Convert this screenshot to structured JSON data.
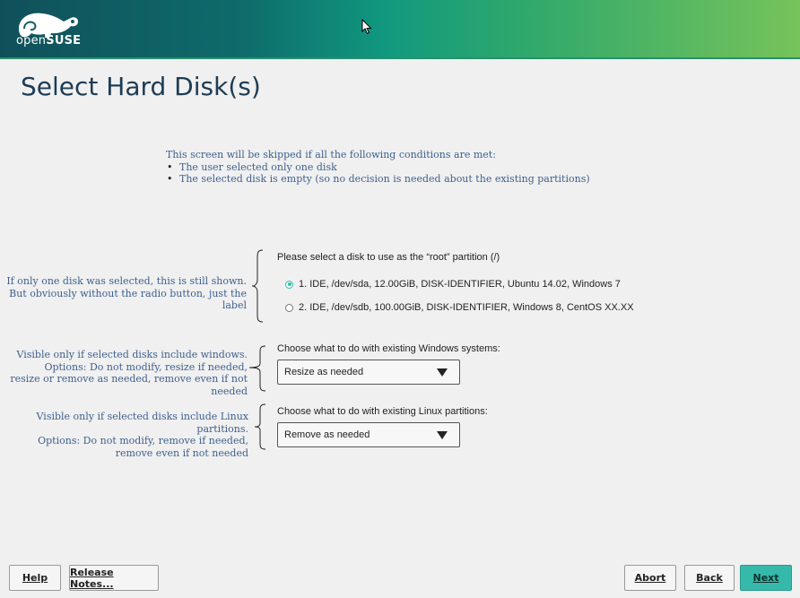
{
  "header": {
    "logo_text_light": "open",
    "logo_text_bold": "SUSE"
  },
  "page": {
    "title": "Select Hard Disk(s)"
  },
  "notes": {
    "top_intro": "This screen will be skipped if all the following conditions are met:",
    "top_bullets": [
      "The user selected only one disk",
      "The selected disk is empty (so no decision is needed about the existing partitions)"
    ],
    "disk_note": [
      "If only one disk was selected, this is still shown.",
      "But obviously without the radio button, just the label"
    ],
    "windows_note": [
      "Visible only if selected disks include windows.",
      "Options: Do not modify, resize if needed,",
      "resize or remove as needed, remove even if not needed"
    ],
    "linux_note": [
      "Visible only if selected disks include Linux partitions.",
      "Options: Do not modify, remove if needed,",
      "remove even if not needed"
    ]
  },
  "disk_selection": {
    "label": "Please select a disk to use as the “root” partition (/)",
    "options": [
      {
        "label": "1. IDE, /dev/sda, 12.00GiB, DISK-IDENTIFIER, Ubuntu 14.02, Windows 7",
        "selected": true
      },
      {
        "label": "2. IDE, /dev/sdb, 100.00GiB, DISK-IDENTIFIER, Windows 8, CentOS XX.XX",
        "selected": false
      }
    ]
  },
  "windows_action": {
    "label": "Choose what to do with existing Windows systems:",
    "value": "Resize as needed"
  },
  "linux_action": {
    "label": "Choose what to do with existing Linux partitions:",
    "value": "Remove as needed"
  },
  "buttons": {
    "help": "Help",
    "release_notes": "Release Notes...",
    "abort": "Abort",
    "back": "Back",
    "next": "Next"
  },
  "colors": {
    "accent": "#35b9ab",
    "note_text": "#3e5f8e",
    "title": "#1d3c55"
  },
  "icons": {
    "logo": "opensuse-chameleon-icon",
    "cursor": "mouse-pointer-icon",
    "dropdown": "triangle-down-icon"
  }
}
